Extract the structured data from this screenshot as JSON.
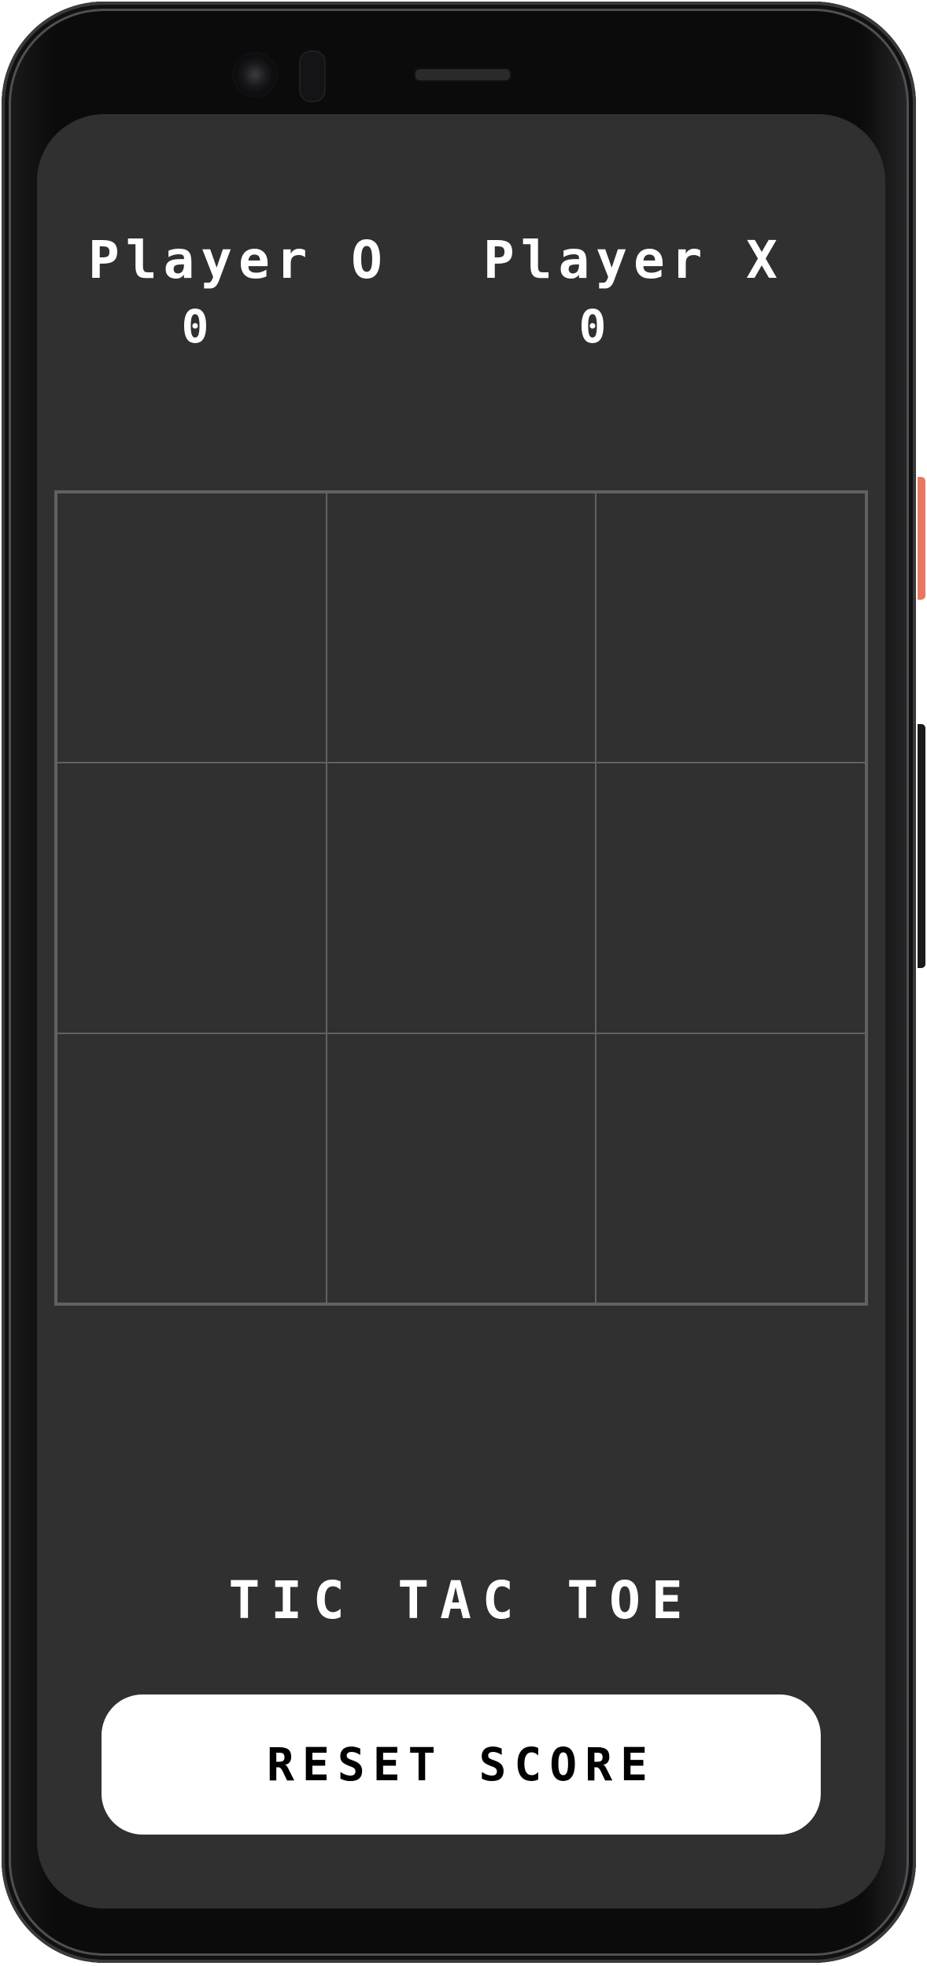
{
  "scoreboard": {
    "player_o": {
      "label": "Player O",
      "score": "0"
    },
    "player_x": {
      "label": "Player X",
      "score": "0"
    }
  },
  "board": {
    "cells": [
      "",
      "",
      "",
      "",
      "",
      "",
      "",
      "",
      ""
    ]
  },
  "title": "TIC TAC TOE",
  "reset_button": {
    "label": "RESET SCORE"
  },
  "colors": {
    "screen_bg": "#303030",
    "grid_line": "#616161",
    "text": "#ffffff",
    "button_bg": "#ffffff",
    "button_text": "#000000",
    "power_button": "#e8785f"
  }
}
